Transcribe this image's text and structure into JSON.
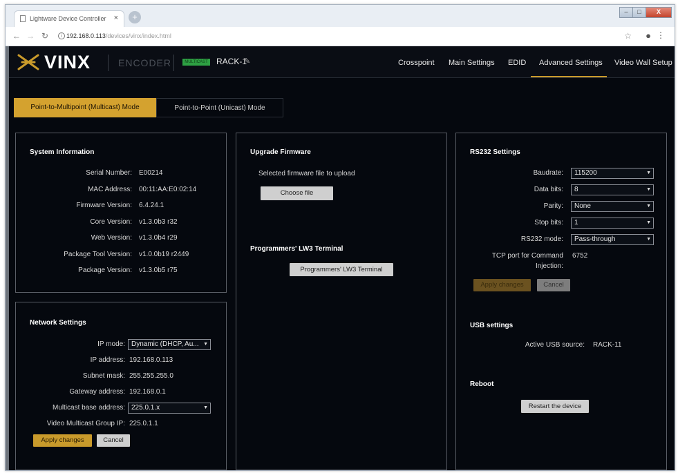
{
  "browser": {
    "tab_title": "Lightware Device Controller",
    "tab_close": "×",
    "newtab": "+",
    "win_min": "–",
    "win_max": "□",
    "win_close": "X",
    "url_host": "192.168.0.113",
    "url_path": "/devices/vinx/index.html"
  },
  "appbar": {
    "logo": "VINX",
    "product": "ENCODER",
    "badge": "MULTICAST",
    "device_name": "RACK-1",
    "nav": [
      "Crosspoint",
      "Main Settings",
      "EDID",
      "Advanced Settings",
      "Video Wall Setup"
    ]
  },
  "modes": {
    "multicast": "Point-to-Multipoint (Multicast) Mode",
    "unicast": "Point-to-Point (Unicast) Mode"
  },
  "system": {
    "title": "System Information",
    "rows": [
      {
        "label": "Serial Number:",
        "value": "E00214"
      },
      {
        "label": "MAC Address:",
        "value": "00:11:AA:E0:02:14"
      },
      {
        "label": "Firmware Version:",
        "value": "6.4.24.1"
      },
      {
        "label": "Core Version:",
        "value": "v1.3.0b3 r32"
      },
      {
        "label": "Web Version:",
        "value": "v1.3.0b4 r29"
      },
      {
        "label": "Package Tool Version:",
        "value": "v1.0.0b19 r2449"
      },
      {
        "label": "Package Version:",
        "value": "v1.3.0b5 r75"
      }
    ]
  },
  "network": {
    "title": "Network Settings",
    "ip_mode_label": "IP mode:",
    "ip_mode_value": "Dynamic (DHCP, Au...",
    "ip_address_label": "IP address:",
    "ip_address_value": "192.168.0.113",
    "subnet_label": "Subnet mask:",
    "subnet_value": "255.255.255.0",
    "gateway_label": "Gateway address:",
    "gateway_value": "192.168.0.1",
    "mcast_base_label": "Multicast base address:",
    "mcast_base_value": "225.0.1.x",
    "mcast_group_label": "Video Multicast Group IP:",
    "mcast_group_value": "225.0.1.1",
    "apply": "Apply changes",
    "cancel": "Cancel"
  },
  "firmware": {
    "title": "Upgrade Firmware",
    "desc": "Selected firmware file to upload",
    "choose": "Choose file",
    "terminal_title": "Programmers' LW3 Terminal",
    "terminal_btn": "Programmers' LW3 Terminal"
  },
  "rs232": {
    "title": "RS232 Settings",
    "baud_label": "Baudrate:",
    "baud_value": "115200",
    "databits_label": "Data bits:",
    "databits_value": "8",
    "parity_label": "Parity:",
    "parity_value": "None",
    "stopbits_label": "Stop bits:",
    "stopbits_value": "1",
    "mode_label": "RS232 mode:",
    "mode_value": "Pass-through",
    "tcp_label_1": "TCP port for Command",
    "tcp_label_2": "Injection:",
    "tcp_value": "6752",
    "apply": "Apply changes",
    "cancel": "Cancel"
  },
  "usb": {
    "title": "USB settings",
    "source_label": "Active USB source:",
    "source_value": "RACK-11"
  },
  "reboot": {
    "title": "Reboot",
    "restart": "Restart the device"
  },
  "colors": {
    "accent": "#c99a2b",
    "background": "#05080e",
    "badge_green": "#2ea043"
  }
}
